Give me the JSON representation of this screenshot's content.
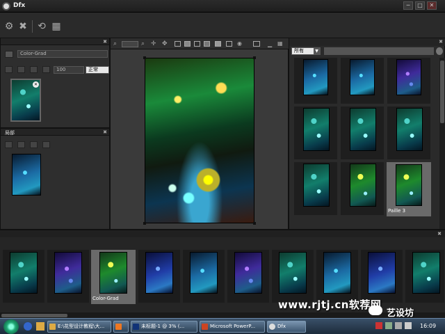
{
  "window": {
    "title": "Dfx"
  },
  "window_controls": {
    "minimize": "─",
    "maximize": "□",
    "close": "✕"
  },
  "top_toolbar": {
    "icons": [
      "gear-icon",
      "close-tools-icon",
      "refresh-icon",
      "frame-icon"
    ]
  },
  "layers_panel": {
    "filter_name": "Color-Grad",
    "opacity_value": "100",
    "blend_mode": "正常"
  },
  "layer2_panel": {
    "title": "局部"
  },
  "preview_panel": {
    "icons": [
      "zoom-icon",
      "fit-icon",
      "pan-icon",
      "hand-icon",
      "split-h-icon",
      "split-v-icon",
      "compare-icon",
      "before-icon",
      "after-icon",
      "grid-icon",
      "eye-icon",
      "settings-icon"
    ]
  },
  "browser_panel": {
    "category_value": "所有",
    "selected_label": "Paille 3"
  },
  "filmstrip": {
    "selected_label": "Color-Grad"
  },
  "taskbar": {
    "items": [
      {
        "label": "E:\\花型设计教程\\大..."
      },
      {
        "label": ""
      },
      {
        "label": "未标题-1 @ 3% (..."
      },
      {
        "label": "Microsoft PowerP..."
      },
      {
        "label": "Dfx"
      }
    ],
    "clock": "16:09"
  },
  "watermark": {
    "url": "www.rjtj.cn软荐网",
    "brand": "艺设坊"
  }
}
